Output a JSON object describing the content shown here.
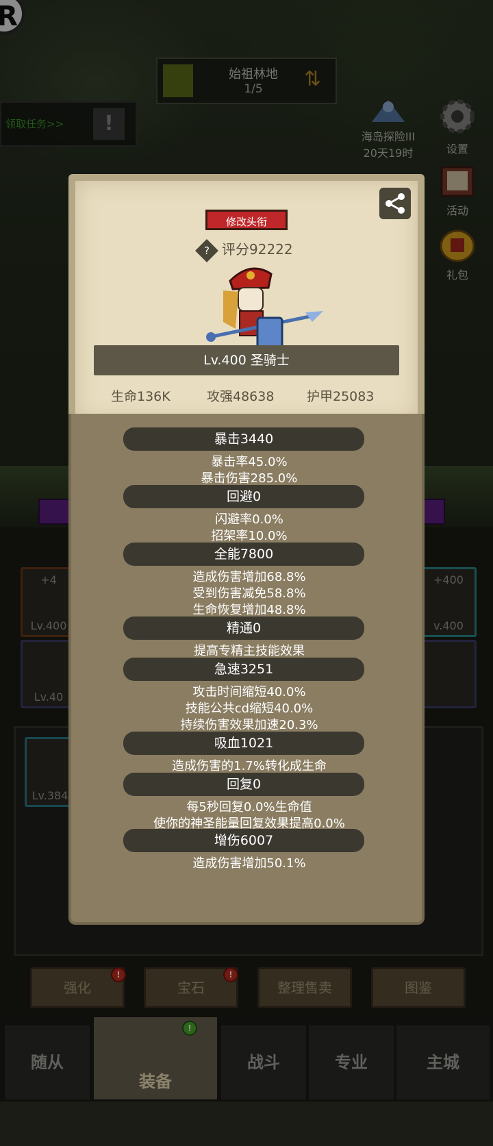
{
  "location": {
    "name": "始祖林地",
    "progress": "1/5"
  },
  "quest": {
    "label": "领取任务>>",
    "alert": "!"
  },
  "right_menu": {
    "island": {
      "label": "海岛探险III",
      "timer": "20天19时"
    },
    "settings": "设置",
    "activity": "活动",
    "gift": "礼包"
  },
  "slots": {
    "left_top": {
      "plus": "+4",
      "level": "Lv.400"
    },
    "left_bottom": {
      "level": "Lv.40"
    },
    "right_top": {
      "plus": "+400",
      "level": "v.400"
    },
    "backpack_first": {
      "level": "Lv.384"
    }
  },
  "actions": [
    "强化",
    "宝石",
    "整理售卖",
    "图鉴"
  ],
  "nav": [
    "随从",
    "装备",
    "战斗",
    "专业",
    "主城"
  ],
  "badges": {
    "red": "!",
    "green": "!"
  },
  "character": {
    "title_button": "修改头衔",
    "score_icon": "?",
    "score": "评分92222",
    "name": "Lv.400 圣骑士",
    "hp": "生命136K",
    "attack": "攻强48638",
    "armor": "护甲25083"
  },
  "stats": [
    {
      "name": "暴击3440",
      "lines": [
        "暴击率45.0%",
        "暴击伤害285.0%"
      ]
    },
    {
      "name": "回避0",
      "lines": [
        "闪避率0.0%",
        "招架率10.0%"
      ]
    },
    {
      "name": "全能7800",
      "lines": [
        "造成伤害增加68.8%",
        "受到伤害减免58.8%",
        "生命恢复增加48.8%"
      ]
    },
    {
      "name": "精通0",
      "lines": [
        "提高专精主技能效果"
      ]
    },
    {
      "name": "急速3251",
      "lines": [
        "攻击时间缩短40.0%",
        "技能公共cd缩短40.0%",
        "持续伤害效果加速20.3%"
      ]
    },
    {
      "name": "吸血1021",
      "lines": [
        "造成伤害的1.7%转化成生命"
      ]
    },
    {
      "name": "回复0",
      "lines": [
        "每5秒回复0.0%生命值",
        "使你的神圣能量回复效果提高0.0%"
      ]
    },
    {
      "name": "增伤6007",
      "lines": [
        "造成伤害增加50.1%"
      ]
    }
  ]
}
